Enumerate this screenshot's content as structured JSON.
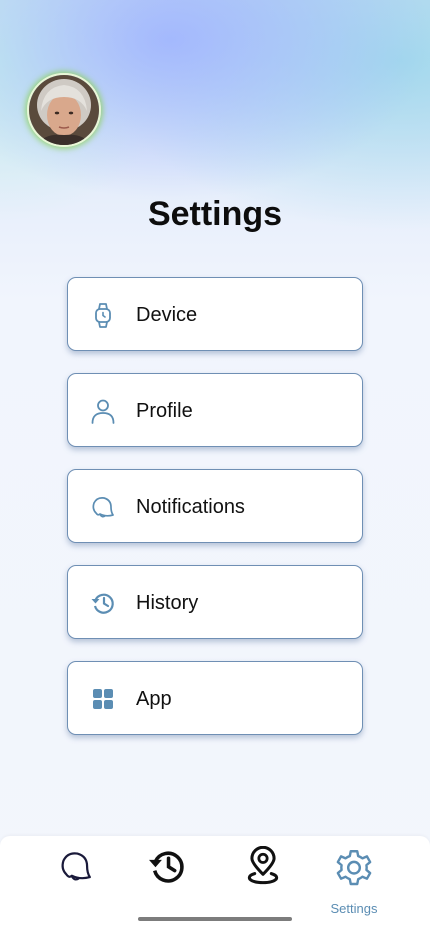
{
  "header": {
    "title": "Settings"
  },
  "avatar": {
    "icon": "user-portrait"
  },
  "menu": {
    "items": [
      {
        "label": "Device",
        "icon": "watch-icon"
      },
      {
        "label": "Profile",
        "icon": "person-icon"
      },
      {
        "label": "Notifications",
        "icon": "bell-icon"
      },
      {
        "label": "History",
        "icon": "history-icon"
      },
      {
        "label": "App",
        "icon": "grid-icon"
      }
    ]
  },
  "bottom_nav": {
    "items": [
      {
        "icon": "bell-icon",
        "label": ""
      },
      {
        "icon": "history-icon",
        "label": ""
      },
      {
        "icon": "location-pin-icon",
        "label": ""
      },
      {
        "icon": "gear-icon",
        "label": "Settings",
        "active": true
      }
    ]
  },
  "colors": {
    "accent": "#5b8db3",
    "card_border": "#6f8fb4",
    "nav_icon": "#1a1a3a"
  }
}
